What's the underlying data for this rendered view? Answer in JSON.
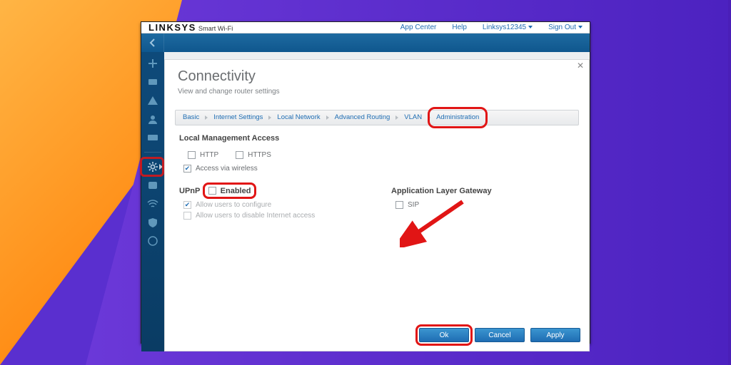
{
  "header": {
    "brand": "LINKSYS",
    "brand_sub": "Smart Wi-Fi",
    "links": {
      "app_center": "App Center",
      "help": "Help",
      "account": "Linksys12345",
      "sign_out": "Sign Out"
    }
  },
  "page": {
    "title": "Connectivity",
    "subtitle": "View and change router settings"
  },
  "tabs": {
    "basic": "Basic",
    "internet": "Internet Settings",
    "local": "Local Network",
    "advrouting": "Advanced Routing",
    "vlan": "VLAN",
    "admin": "Administration"
  },
  "lma": {
    "title": "Local Management Access",
    "http": "HTTP",
    "https": "HTTPS",
    "wireless": "Access via wireless",
    "http_checked": false,
    "https_checked": false,
    "wireless_checked": true
  },
  "upnp": {
    "title": "UPnP",
    "enabled_label": "Enabled",
    "enabled_checked": false,
    "allow_configure": "Allow users to configure",
    "allow_configure_checked": true,
    "allow_disable_net": "Allow users to disable Internet access",
    "allow_disable_net_checked": false
  },
  "alg": {
    "title": "Application Layer Gateway",
    "sip": "SIP",
    "sip_checked": false
  },
  "buttons": {
    "ok": "Ok",
    "cancel": "Cancel",
    "apply": "Apply"
  }
}
